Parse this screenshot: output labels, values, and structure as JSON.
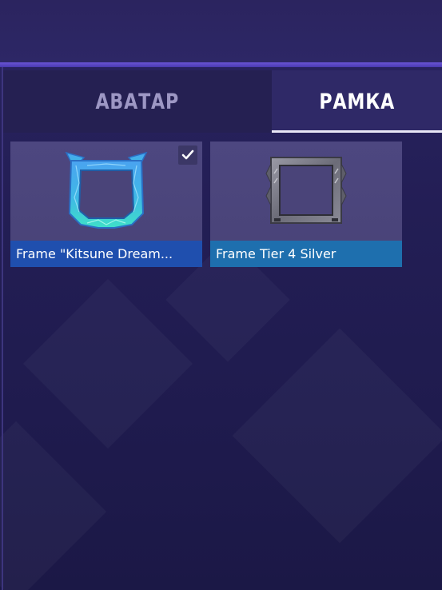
{
  "tabs": [
    {
      "label": "АВАТАР",
      "active": false
    },
    {
      "label": "РАМКА",
      "active": true
    }
  ],
  "items": [
    {
      "label": "Frame \"Kitsune Dream...",
      "selected": true,
      "icon": "kitsune-frame-icon"
    },
    {
      "label": "Frame Tier 4 Silver",
      "selected": false,
      "icon": "silver-frame-icon"
    }
  ],
  "colors": {
    "active_underline": "#e8e6f5",
    "card_label_blue": "#1f4fae",
    "card_label_teal": "#1e6fae",
    "accent_divider": "#6a55d6"
  }
}
